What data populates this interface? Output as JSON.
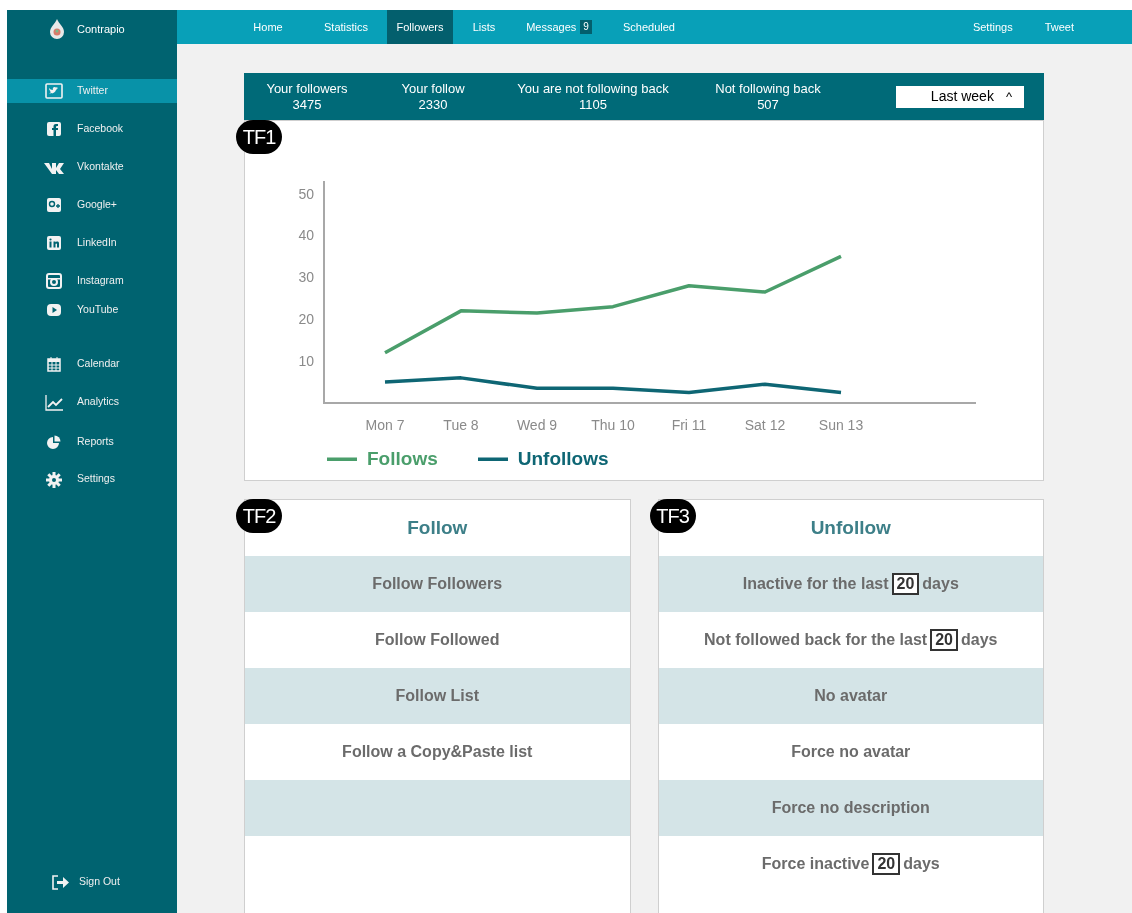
{
  "brand": {
    "name": "Contrapio"
  },
  "sidebar": {
    "networks": [
      {
        "label": "Twitter",
        "selected": true
      },
      {
        "label": "Facebook",
        "selected": false
      },
      {
        "label": "Vkontakte",
        "selected": false
      },
      {
        "label": "Google+",
        "selected": false
      },
      {
        "label": "LinkedIn",
        "selected": false
      },
      {
        "label": "Instagram",
        "selected": false
      },
      {
        "label": "YouTube",
        "selected": false
      }
    ],
    "tools": [
      {
        "label": "Calendar",
        "selected": false
      },
      {
        "label": "Analytics",
        "selected": false
      },
      {
        "label": "Reports",
        "selected": false
      },
      {
        "label": "Settings",
        "selected": false
      }
    ],
    "sign_out": "Sign Out"
  },
  "nav": {
    "items": [
      {
        "label": "Home",
        "selected": false
      },
      {
        "label": "Statistics",
        "selected": false
      },
      {
        "label": "Followers",
        "selected": true
      },
      {
        "label": "Lists",
        "selected": false
      },
      {
        "label": "Messages",
        "selected": false,
        "badge": "9"
      },
      {
        "label": "Scheduled",
        "selected": false
      }
    ],
    "right_items": [
      "Settings",
      "Tweet"
    ]
  },
  "stats": [
    {
      "label": "Your followers",
      "value": "3475"
    },
    {
      "label": "Your follow",
      "value": "2330"
    },
    {
      "label": "You are not following back",
      "value": "1105"
    },
    {
      "label": "Not following back",
      "value": "507"
    }
  ],
  "period_select": {
    "value": "Last week",
    "caret": "^"
  },
  "markers": [
    "TF1",
    "TF2",
    "TF3"
  ],
  "chart_data": {
    "type": "line",
    "categories": [
      "Mon 7",
      "Tue 8",
      "Wed 9",
      "Thu 10",
      "Fri 11",
      "Sat 12",
      "Sun 13"
    ],
    "ylim": [
      0,
      53
    ],
    "yticks": [
      10,
      20,
      30,
      40,
      50
    ],
    "series": [
      {
        "name": "Follows",
        "color": "#4a9e6b",
        "values": [
          12,
          22,
          21.5,
          23,
          28,
          26.5,
          35
        ]
      },
      {
        "name": "Unfollows",
        "color": "#0e6674",
        "values": [
          5,
          6,
          3.5,
          3.5,
          2.5,
          4.5,
          2.5
        ]
      }
    ]
  },
  "follow_panel": {
    "title": "Follow",
    "rows": [
      {
        "kind": "text",
        "label": "Follow Followers"
      },
      {
        "kind": "text",
        "label": "Follow Followed"
      },
      {
        "kind": "text",
        "label": "Follow List"
      },
      {
        "kind": "text",
        "label": "Follow a Copy&Paste list"
      },
      {
        "kind": "empty"
      }
    ]
  },
  "unfollow_panel": {
    "title": "Unfollow",
    "rows": [
      {
        "kind": "input",
        "before": "Inactive for the last",
        "value": "20",
        "after": "days"
      },
      {
        "kind": "input",
        "before": "Not followed back for the last",
        "value": "20",
        "after": "days"
      },
      {
        "kind": "text",
        "label": "No avatar"
      },
      {
        "kind": "text",
        "label": "Force no avatar"
      },
      {
        "kind": "text",
        "label": "Force no description"
      },
      {
        "kind": "input",
        "before": "Force inactive",
        "value": "20",
        "after": "days"
      }
    ]
  }
}
